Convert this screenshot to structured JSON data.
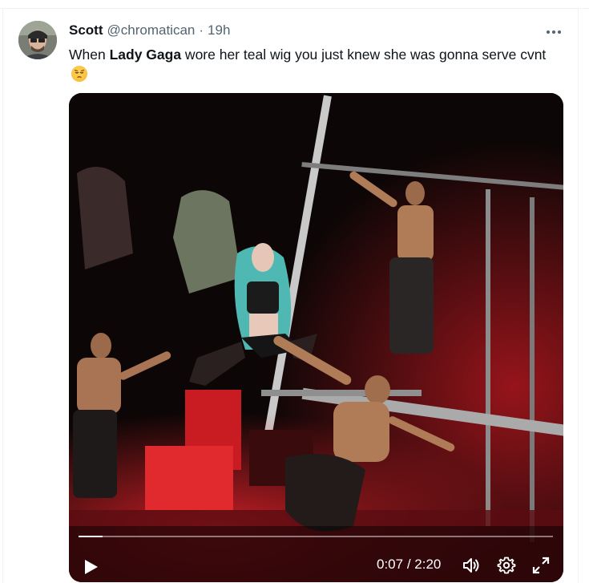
{
  "tweet": {
    "author": {
      "display_name": "Scott",
      "handle": "@chromatican",
      "separator": "·",
      "time": "19h",
      "avatar_icon": "avatar-photo"
    },
    "text": {
      "prefix": "When ",
      "mention": "Lady Gaga",
      "suffix": " wore her teal wig you just knew she was gonna serve cvnt",
      "emoji_icon": "pensive-face-emoji"
    },
    "menu_icon": "more-horizontal-icon"
  },
  "video": {
    "current_time": "0:07",
    "separator": " / ",
    "duration": "2:20",
    "progress": 0.05,
    "controls": [
      "play-icon",
      "volume-icon",
      "settings-gear-icon",
      "fullscreen-icon"
    ],
    "colors": {
      "wig_teal": "#4fb8b2",
      "stage_red": "#d41c24"
    }
  }
}
